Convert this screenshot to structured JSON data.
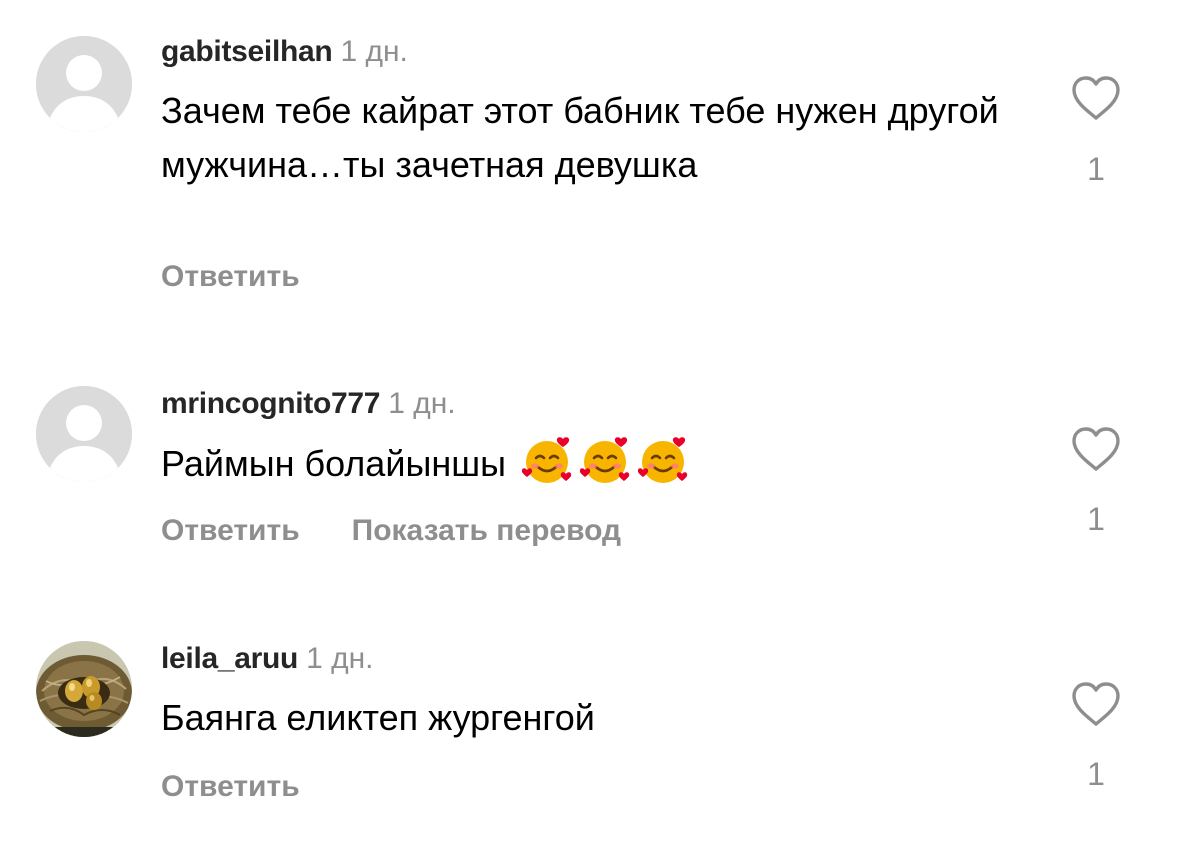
{
  "comments": [
    {
      "username": "gabitseilhan",
      "time": "1 дн.",
      "text": "Зачем тебе кайрат этот бабник тебе нужен другой мужчина…ты зачетная девушка",
      "reply_label": "Ответить",
      "like_count": "1",
      "avatar": "default-avatar-icon"
    },
    {
      "username": "mrincognito777",
      "time": "1 дн.",
      "text": "Раймын болайыншы",
      "emojis": [
        "smiling-face-with-hearts-emoji",
        "smiling-face-with-hearts-emoji",
        "smiling-face-with-hearts-emoji"
      ],
      "reply_label": "Ответить",
      "translate_label": "Показать перевод",
      "like_count": "1",
      "avatar": "default-avatar-icon"
    },
    {
      "username": "leila_aruu",
      "time": "1 дн.",
      "text": "Баянга еликтеп жургенгой",
      "reply_label": "Ответить",
      "like_count": "1",
      "avatar": "bird-nest-golden-eggs-photo"
    }
  ],
  "colors": {
    "username": "#262626",
    "secondary": "#8e8e8e",
    "avatar_placeholder": "#dbdbdb"
  }
}
